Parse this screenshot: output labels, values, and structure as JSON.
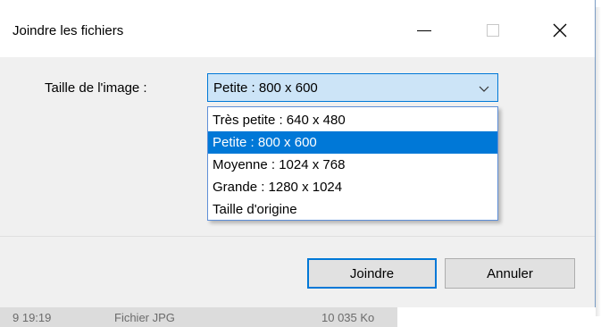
{
  "dialog": {
    "title": "Joindre les fichiers",
    "accent_color": "#0078d7",
    "image_size_label": "Taille de l'image :",
    "combo": {
      "selected_value": "Petite : 800 x 600",
      "options": [
        "Très petite : 640 x 480",
        "Petite : 800 x 600",
        "Moyenne : 1024 x 768",
        "Grande : 1280 x 1024",
        "Taille d'origine"
      ],
      "highlighted_index": 1
    },
    "buttons": {
      "join": "Joindre",
      "cancel": "Annuler"
    },
    "titlebar_icons": {
      "minimize": "minimize-icon",
      "maximize": "maximize-icon",
      "close": "close-icon"
    }
  },
  "background_row": {
    "time": "9 19:19",
    "type": "Fichier JPG",
    "size": "10 035 Ko"
  }
}
